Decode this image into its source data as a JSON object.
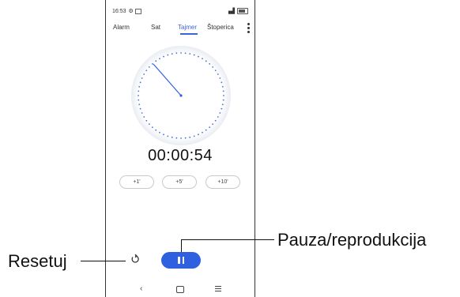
{
  "status_bar": {
    "time": "16:53",
    "icons": [
      "gear-icon",
      "image-icon"
    ],
    "right_icons": [
      "signal-icon",
      "battery-icon"
    ]
  },
  "tabs": [
    {
      "label": "Alarm",
      "active": false
    },
    {
      "label": "Sat",
      "active": false
    },
    {
      "label": "Tajmer",
      "active": true
    },
    {
      "label": "Štoperica",
      "active": false
    }
  ],
  "timer": {
    "display": "00:00:54"
  },
  "quick_add": [
    "+1'",
    "+5'",
    "+10'"
  ],
  "controls": {
    "reset_icon": "reset-icon",
    "pause_icon": "pause-icon"
  },
  "callouts": {
    "reset": "Resetuj",
    "pause_play": "Pauza/reprodukcija"
  },
  "colors": {
    "accent": "#2f60e0",
    "tab_active": "#3d63d8",
    "dial_dots": "#4a6fe0"
  }
}
